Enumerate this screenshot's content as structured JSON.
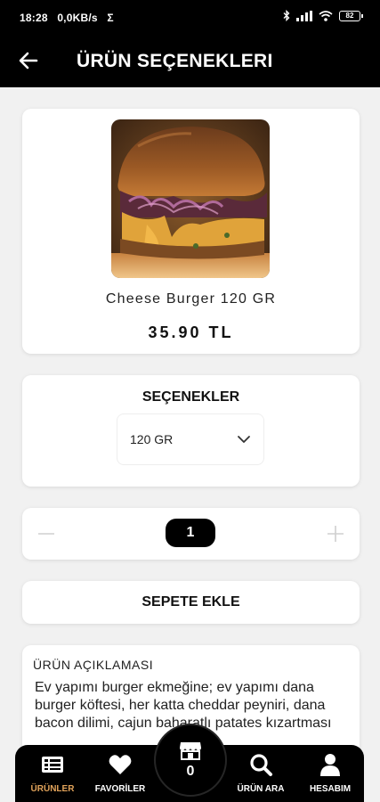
{
  "status_bar": {
    "time": "18:28",
    "speed": "0,0KB/s",
    "sigma": "Σ",
    "battery": "82"
  },
  "app_bar": {
    "title": "ÜRÜN SEÇENEKLERI"
  },
  "product": {
    "name": "Cheese Burger 120 GR",
    "price": "35.90 TL"
  },
  "options": {
    "title": "SEÇENEKLER",
    "selected": "120 GR"
  },
  "quantity": {
    "value": "1"
  },
  "cart_button": {
    "label": "SEPETE EKLE"
  },
  "description": {
    "title": "ÜRÜN AÇIKLAMASI",
    "text": "Ev yapımı burger ekmeğine; ev yapımı dana burger köftesi, her katta cheddar peyniri, dana bacon dilimi, cajun baharatlı patates kızartması"
  },
  "bottom_nav": {
    "items": [
      {
        "label": "ÜRÜNLER",
        "icon": "list-icon"
      },
      {
        "label": "FAVORİLER",
        "icon": "heart-icon"
      },
      {
        "label": "ÜRÜN ARA",
        "icon": "search-icon"
      },
      {
        "label": "HESABIM",
        "icon": "user-icon"
      }
    ],
    "cart_count": "0",
    "active_color": "#e1a35a"
  }
}
